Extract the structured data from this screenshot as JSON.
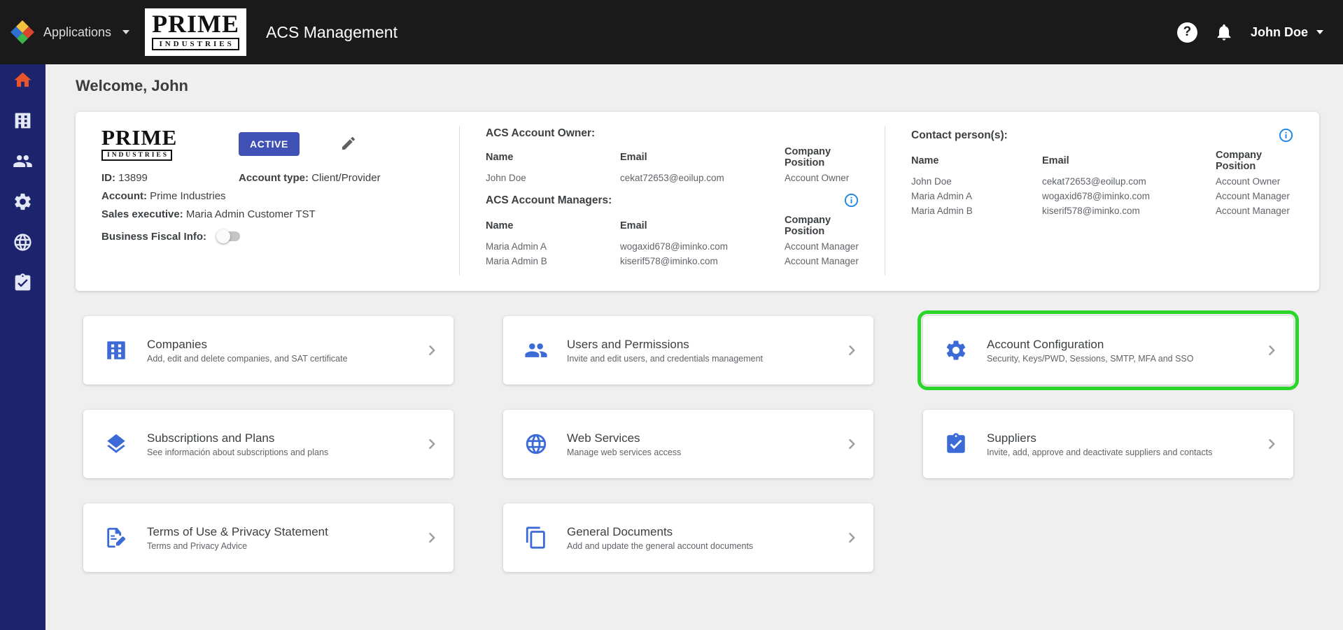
{
  "colors": {
    "header_bg": "#1a1a1a",
    "sidebar_bg": "#1b246d",
    "page_bg": "#efefef",
    "accent_blue": "#3c6ad6",
    "active_badge_blue": "#3f51b5",
    "info_icon_blue": "#1e88e5",
    "highlight_green": "#2bd62b",
    "home_icon_orange": "#e8542c"
  },
  "header": {
    "applications_label": "Applications",
    "brand_line1": "PRIME",
    "brand_line2": "INDUSTRIES",
    "app_title": "ACS Management",
    "help_glyph": "?",
    "user_name": "John Doe"
  },
  "sidebar": {
    "items": [
      {
        "id": "home",
        "icon": "home-icon"
      },
      {
        "id": "companies",
        "icon": "building-icon"
      },
      {
        "id": "users",
        "icon": "users-icon"
      },
      {
        "id": "account-configuration",
        "icon": "gear-icon"
      },
      {
        "id": "web-services",
        "icon": "globe-icon"
      },
      {
        "id": "suppliers",
        "icon": "clipboard-check-icon"
      }
    ]
  },
  "main": {
    "welcome": "Welcome, John",
    "account": {
      "brand_line1": "PRIME",
      "brand_line2": "INDUSTRIES",
      "status_badge": "ACTIVE",
      "id_label": "ID:",
      "id_value": "13899",
      "account_type_label": "Account type:",
      "account_type_value": "Client/Provider",
      "account_label": "Account:",
      "account_value": "Prime Industries",
      "sales_executive_label": "Sales executive:",
      "sales_executive_value": "Maria Admin Customer TST",
      "business_fiscal_label": "Business Fiscal Info:",
      "owner": {
        "title": "ACS Account Owner:",
        "headers": [
          "Name",
          "Email",
          "Company Position"
        ],
        "rows": [
          [
            "John Doe",
            "cekat72653@eoilup.com",
            "Account Owner"
          ]
        ]
      },
      "managers": {
        "title": "ACS Account Managers:",
        "headers": [
          "Name",
          "Email",
          "Company Position"
        ],
        "rows": [
          [
            "Maria Admin A",
            "wogaxid678@iminko.com",
            "Account Manager"
          ],
          [
            "Maria Admin B",
            "kiserif578@iminko.com",
            "Account Manager"
          ]
        ]
      },
      "contacts": {
        "title": "Contact person(s):",
        "headers": [
          "Name",
          "Email",
          "Company Position"
        ],
        "rows": [
          [
            "John Doe",
            "cekat72653@eoilup.com",
            "Account Owner"
          ],
          [
            "Maria Admin A",
            "wogaxid678@iminko.com",
            "Account Manager"
          ],
          [
            "Maria Admin B",
            "kiserif578@iminko.com",
            "Account Manager"
          ]
        ]
      }
    },
    "cards": [
      {
        "title": "Companies",
        "subtitle": "Add, edit and delete companies, and SAT certificate",
        "icon": "building-icon",
        "highlighted": false
      },
      {
        "title": "Users and Permissions",
        "subtitle": "Invite and edit users, and credentials management",
        "icon": "users-icon",
        "highlighted": false
      },
      {
        "title": "Account Configuration",
        "subtitle": "Security, Keys/PWD, Sessions, SMTP, MFA and SSO",
        "icon": "gear-icon",
        "highlighted": true
      },
      {
        "title": "Subscriptions and Plans",
        "subtitle": "See información about subscriptions and plans",
        "icon": "layers-icon",
        "highlighted": false
      },
      {
        "title": "Web Services",
        "subtitle": "Manage web services access",
        "icon": "globe-icon",
        "highlighted": false
      },
      {
        "title": "Suppliers",
        "subtitle": "Invite, add, approve and deactivate suppliers and contacts",
        "icon": "clipboard-check-icon",
        "highlighted": false
      },
      {
        "title": "Terms of Use & Privacy Statement",
        "subtitle": "Terms and Privacy Advice",
        "icon": "document-edit-icon",
        "highlighted": false
      },
      {
        "title": "General Documents",
        "subtitle": "Add and update the general account documents",
        "icon": "documents-icon",
        "highlighted": false
      }
    ]
  }
}
